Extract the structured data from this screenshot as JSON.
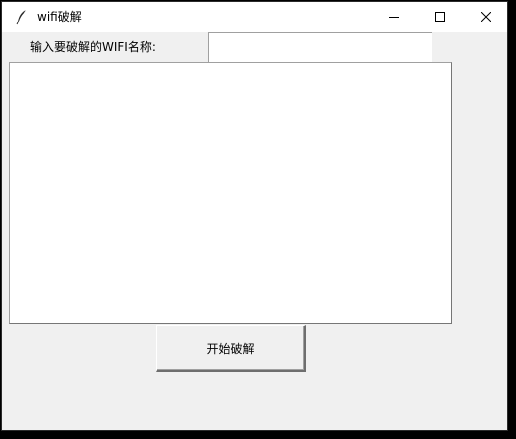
{
  "window": {
    "title": "wifi破解",
    "icon": "feather-icon",
    "controls": {
      "minimize": "minimize-icon",
      "maximize": "maximize-icon",
      "close": "close-icon"
    }
  },
  "form": {
    "label": "输入要破解的WIFI名称:",
    "wifi_name_value": "",
    "output_text": ""
  },
  "actions": {
    "start_label": "开始破解"
  },
  "colors": {
    "window_bg": "#f0f0f0",
    "titlebar_bg": "#ffffff",
    "field_bg": "#ffffff",
    "border": "#a0a0a0"
  }
}
